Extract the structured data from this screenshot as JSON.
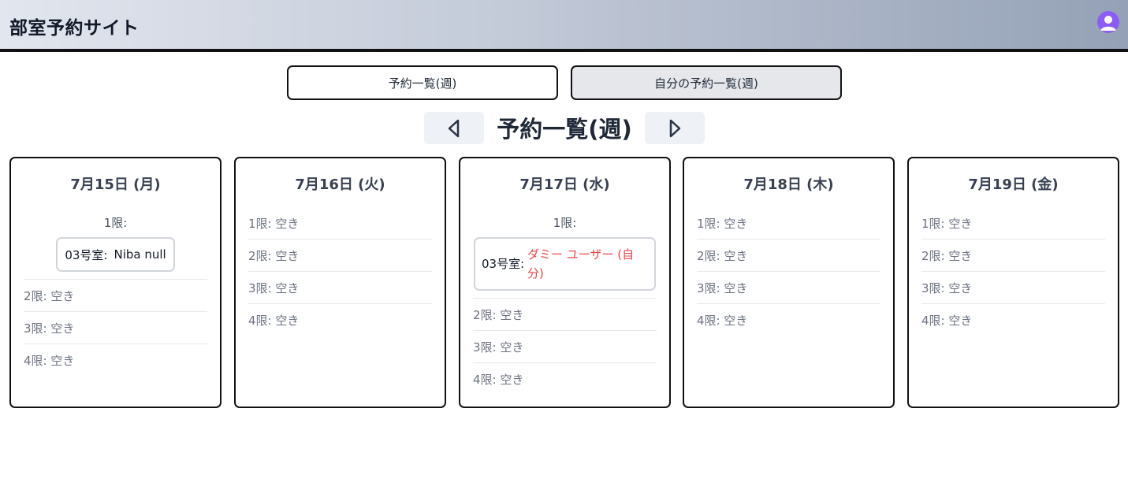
{
  "header": {
    "title": "部室予約サイト",
    "avatar_icon": "user-avatar-icon"
  },
  "tabs": [
    {
      "label": "予約一覧(週)"
    },
    {
      "label": "自分の予約一覧(週)"
    }
  ],
  "page": {
    "title": "予約一覧(週)",
    "prev_icon": "triangle-left-icon",
    "next_icon": "triangle-right-icon"
  },
  "colors": {
    "own_booking": "#ef4444",
    "avatar": "#8b5cf6"
  },
  "days": [
    {
      "title": "7月15日 (月)",
      "booked_slot_label": "1限:",
      "booking": {
        "room": "03号室:",
        "user": "Niba null"
      },
      "slots": [
        "2限: 空き",
        "3限: 空き",
        "4限: 空き"
      ]
    },
    {
      "title": "7月16日 (火)",
      "slots": [
        "1限: 空き",
        "2限: 空き",
        "3限: 空き",
        "4限: 空き"
      ]
    },
    {
      "title": "7月17日 (水)",
      "booked_slot_label": "1限:",
      "booking": {
        "room": "03号室:",
        "user": "ダミー ユーザー (自分)"
      },
      "slots": [
        "2限: 空き",
        "3限: 空き",
        "4限: 空き"
      ]
    },
    {
      "title": "7月18日 (木)",
      "slots": [
        "1限: 空き",
        "2限: 空き",
        "3限: 空き",
        "4限: 空き"
      ]
    },
    {
      "title": "7月19日 (金)",
      "slots": [
        "1限: 空き",
        "2限: 空き",
        "3限: 空き",
        "4限: 空き"
      ]
    }
  ]
}
